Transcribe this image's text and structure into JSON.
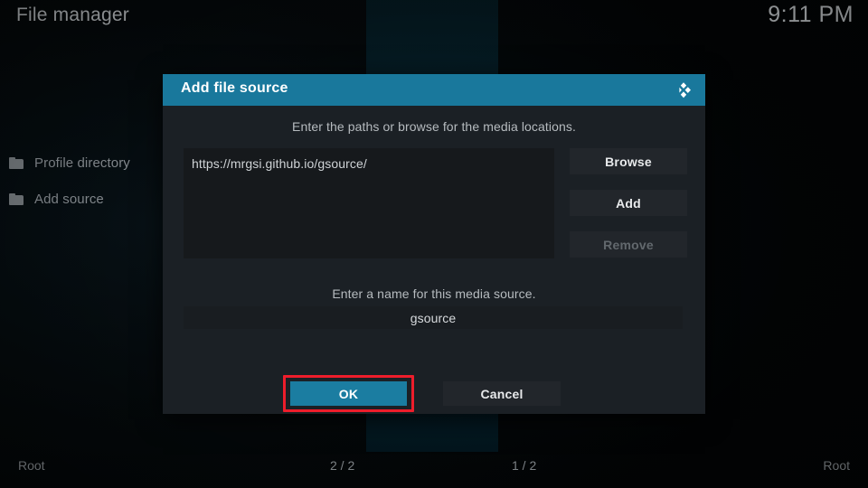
{
  "window": {
    "title": "File manager",
    "clock": "9:11 PM"
  },
  "sidebar": {
    "items": [
      {
        "label": "Profile directory",
        "icon": "folder-icon"
      },
      {
        "label": "Add source",
        "icon": "folder-icon"
      }
    ]
  },
  "statusbar": {
    "left_path": "Root",
    "left_count": "2 / 2",
    "right_count": "1 / 2",
    "right_path": "Root"
  },
  "dialog": {
    "title": "Add file source",
    "logo_icon": "kodi-logo-icon",
    "paths_hint": "Enter the paths or browse for the media locations.",
    "path_value": "https://mrgsi.github.io/gsource/",
    "buttons": {
      "browse": "Browse",
      "add": "Add",
      "remove": "Remove"
    },
    "name_hint": "Enter a name for this media source.",
    "name_value": "gsource",
    "ok": "OK",
    "cancel": "Cancel"
  },
  "colors": {
    "accent_teal": "#19789c",
    "ok_button_teal": "#1b7da1",
    "highlight_red": "#ee1d2b",
    "dialog_bg": "#1b2025",
    "field_bg": "#16191c",
    "button_bg": "#22262b",
    "disabled_text": "#62686d"
  }
}
